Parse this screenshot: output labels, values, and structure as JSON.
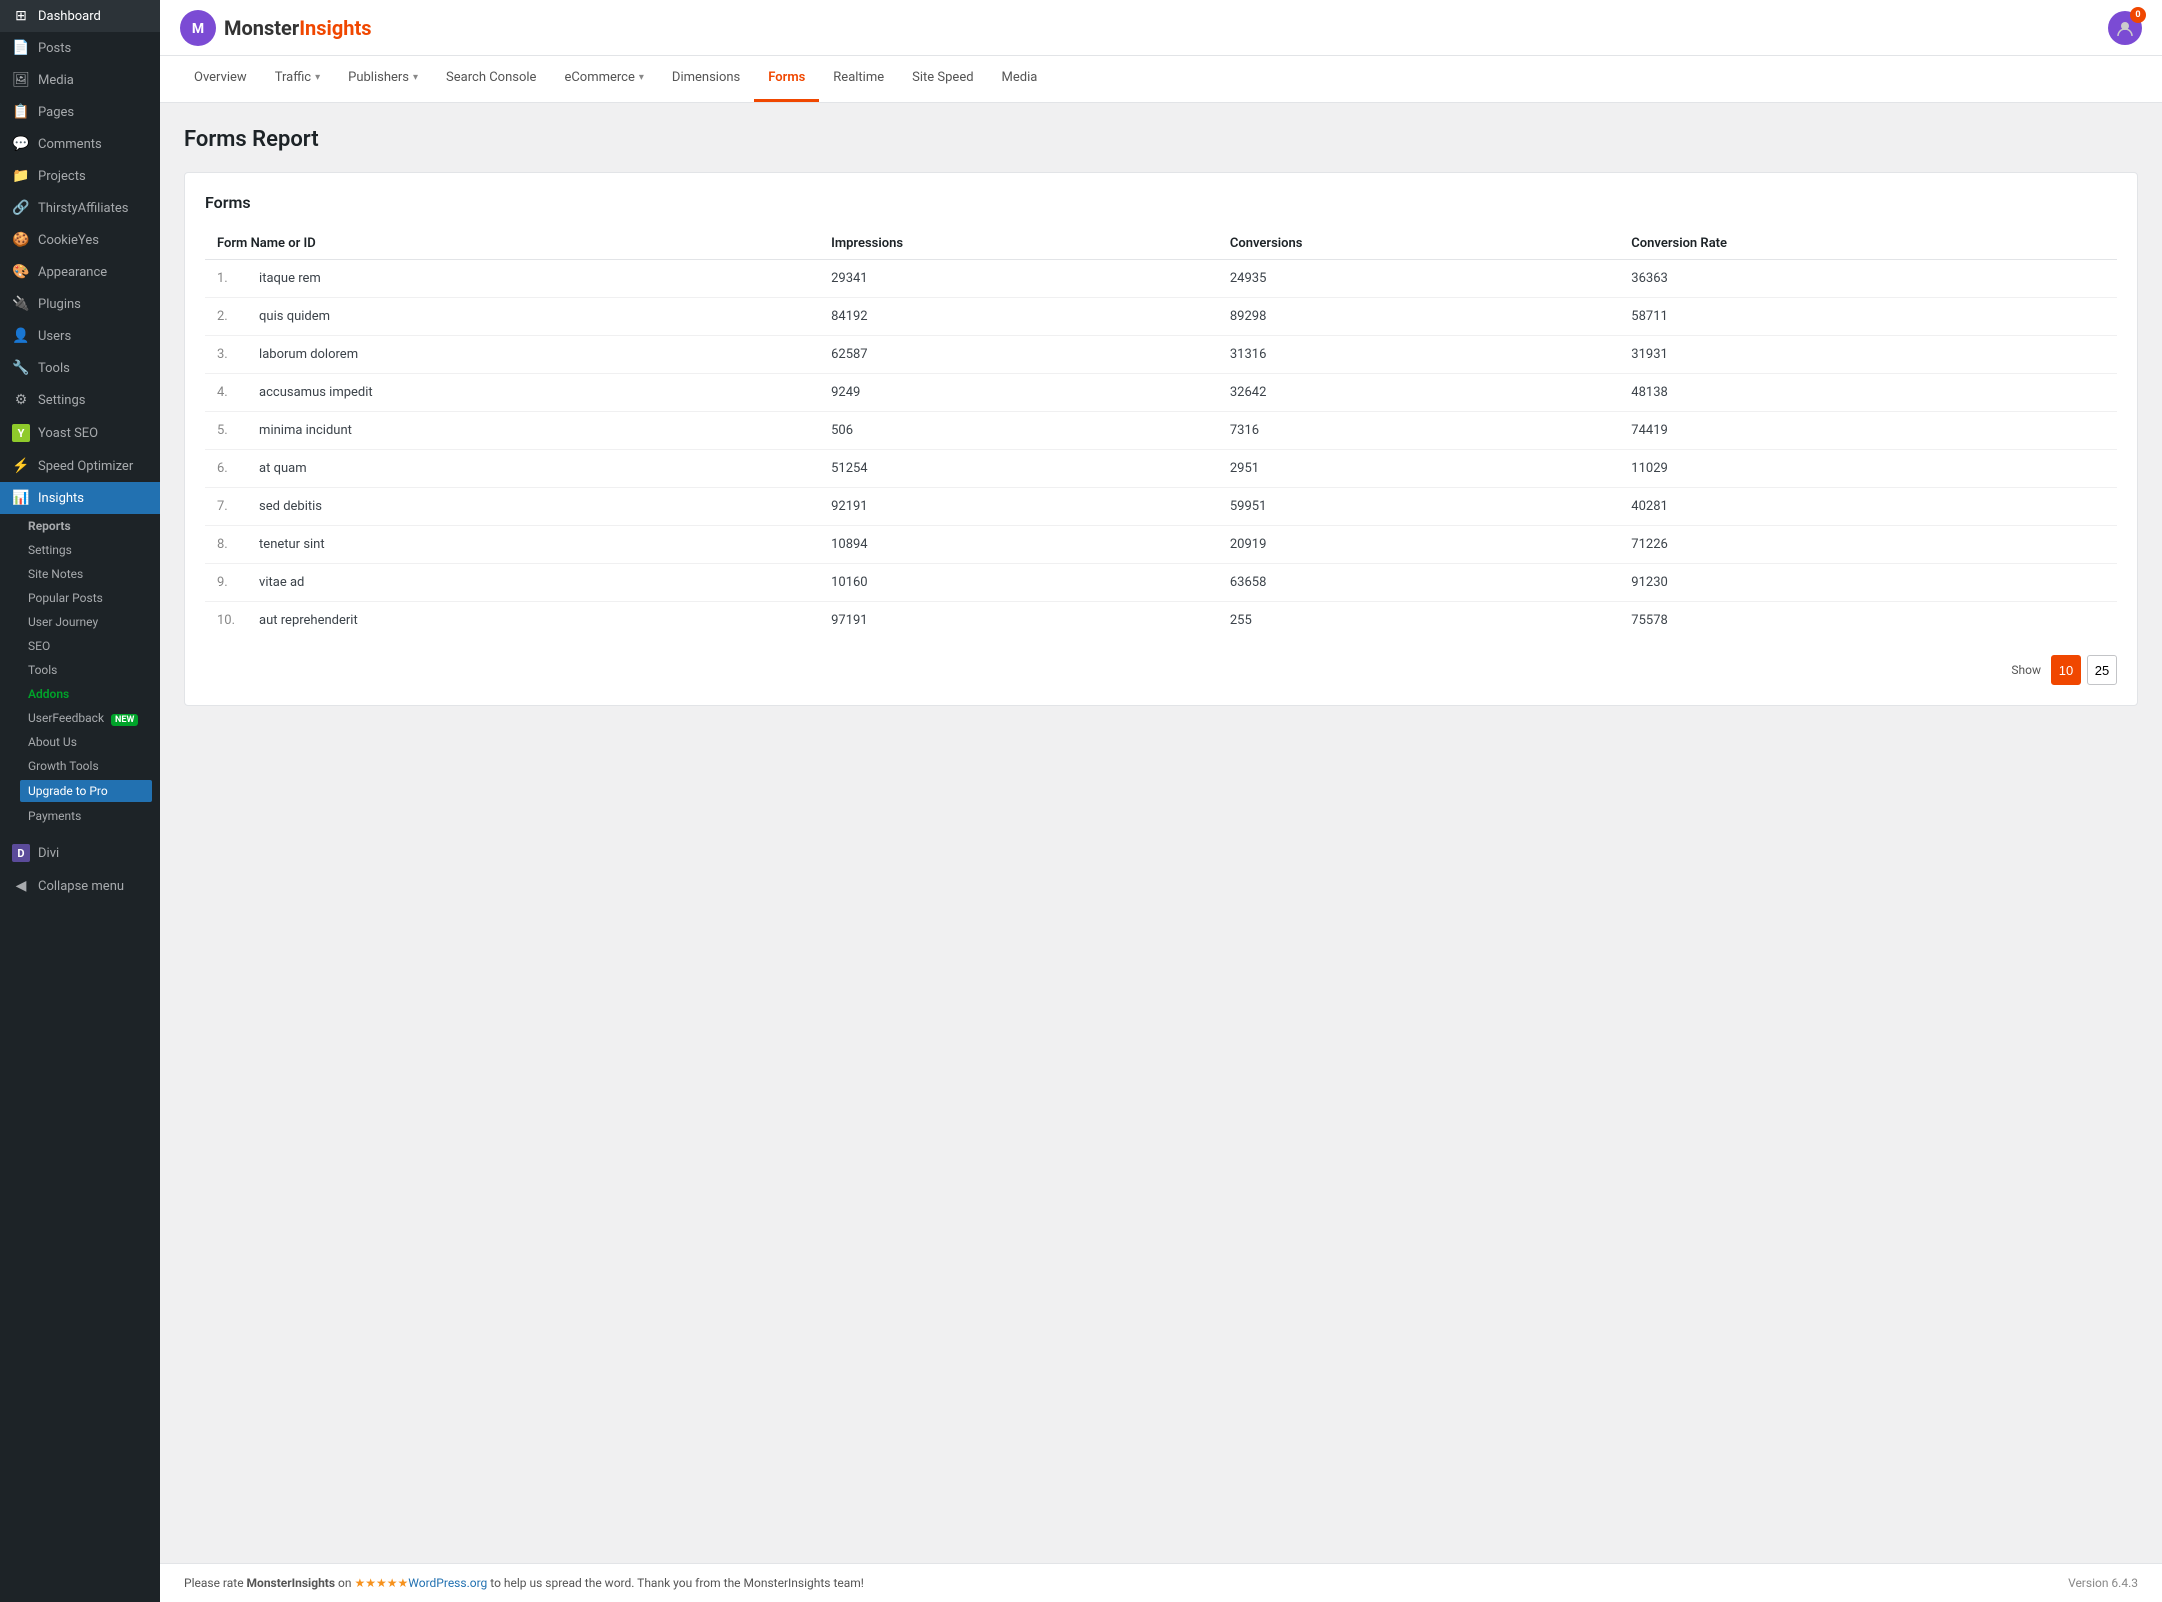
{
  "sidebar": {
    "items": [
      {
        "id": "dashboard",
        "label": "Dashboard",
        "icon": "⊞"
      },
      {
        "id": "posts",
        "label": "Posts",
        "icon": "📄"
      },
      {
        "id": "media",
        "label": "Media",
        "icon": "🖼"
      },
      {
        "id": "pages",
        "label": "Pages",
        "icon": "📋"
      },
      {
        "id": "comments",
        "label": "Comments",
        "icon": "💬"
      },
      {
        "id": "projects",
        "label": "Projects",
        "icon": "📁"
      },
      {
        "id": "thirstyaffiliates",
        "label": "ThirstyAffiliates",
        "icon": "🔗"
      },
      {
        "id": "cookieyes",
        "label": "CookieYes",
        "icon": "🍪"
      },
      {
        "id": "appearance",
        "label": "Appearance",
        "icon": "🎨"
      },
      {
        "id": "plugins",
        "label": "Plugins",
        "icon": "🔌"
      },
      {
        "id": "users",
        "label": "Users",
        "icon": "👤"
      },
      {
        "id": "tools",
        "label": "Tools",
        "icon": "🔧"
      },
      {
        "id": "settings",
        "label": "Settings",
        "icon": "⚙"
      },
      {
        "id": "yoast-seo",
        "label": "Yoast SEO",
        "icon": "Y"
      },
      {
        "id": "speed-optimizer",
        "label": "Speed Optimizer",
        "icon": "⚡"
      },
      {
        "id": "insights",
        "label": "Insights",
        "icon": "📊",
        "active": true
      }
    ],
    "sub_items": [
      {
        "id": "reports",
        "label": "Reports",
        "bold": true
      },
      {
        "id": "settings",
        "label": "Settings"
      },
      {
        "id": "site-notes",
        "label": "Site Notes"
      },
      {
        "id": "popular-posts",
        "label": "Popular Posts"
      },
      {
        "id": "user-journey",
        "label": "User Journey"
      },
      {
        "id": "seo",
        "label": "SEO"
      },
      {
        "id": "tools",
        "label": "Tools"
      },
      {
        "id": "addons",
        "label": "Addons",
        "green": true
      },
      {
        "id": "userfeedback",
        "label": "UserFeedback",
        "new": true
      },
      {
        "id": "about-us",
        "label": "About Us"
      },
      {
        "id": "growth-tools",
        "label": "Growth Tools"
      },
      {
        "id": "upgrade-to-pro",
        "label": "Upgrade to Pro",
        "highlight": true
      },
      {
        "id": "payments",
        "label": "Payments"
      }
    ],
    "divi": {
      "label": "Divi",
      "icon": "D"
    },
    "collapse": "Collapse menu"
  },
  "header": {
    "logo_monster": "Monster",
    "logo_insights": "Insights",
    "avatar_badge": "0"
  },
  "nav": {
    "tabs": [
      {
        "id": "overview",
        "label": "Overview",
        "active": false,
        "has_arrow": false
      },
      {
        "id": "traffic",
        "label": "Traffic",
        "active": false,
        "has_arrow": true
      },
      {
        "id": "publishers",
        "label": "Publishers",
        "active": false,
        "has_arrow": true
      },
      {
        "id": "search-console",
        "label": "Search Console",
        "active": false,
        "has_arrow": false
      },
      {
        "id": "ecommerce",
        "label": "eCommerce",
        "active": false,
        "has_arrow": true
      },
      {
        "id": "dimensions",
        "label": "Dimensions",
        "active": false,
        "has_arrow": false
      },
      {
        "id": "forms",
        "label": "Forms",
        "active": true,
        "has_arrow": false
      },
      {
        "id": "realtime",
        "label": "Realtime",
        "active": false,
        "has_arrow": false
      },
      {
        "id": "site-speed",
        "label": "Site Speed",
        "active": false,
        "has_arrow": false
      },
      {
        "id": "media",
        "label": "Media",
        "active": false,
        "has_arrow": false
      }
    ]
  },
  "page": {
    "title": "Forms Report",
    "table_title": "Forms",
    "columns": {
      "name": "Form Name or ID",
      "impressions": "Impressions",
      "conversions": "Conversions",
      "conversion_rate": "Conversion Rate"
    },
    "rows": [
      {
        "num": "1.",
        "name": "itaque rem",
        "impressions": "29341",
        "conversions": "24935",
        "conversion_rate": "36363"
      },
      {
        "num": "2.",
        "name": "quis quidem",
        "impressions": "84192",
        "conversions": "89298",
        "conversion_rate": "58711"
      },
      {
        "num": "3.",
        "name": "laborum dolorem",
        "impressions": "62587",
        "conversions": "31316",
        "conversion_rate": "31931"
      },
      {
        "num": "4.",
        "name": "accusamus impedit",
        "impressions": "9249",
        "conversions": "32642",
        "conversion_rate": "48138"
      },
      {
        "num": "5.",
        "name": "minima incidunt",
        "impressions": "506",
        "conversions": "7316",
        "conversion_rate": "74419"
      },
      {
        "num": "6.",
        "name": "at quam",
        "impressions": "51254",
        "conversions": "2951",
        "conversion_rate": "11029"
      },
      {
        "num": "7.",
        "name": "sed debitis",
        "impressions": "92191",
        "conversions": "59951",
        "conversion_rate": "40281"
      },
      {
        "num": "8.",
        "name": "tenetur sint",
        "impressions": "10894",
        "conversions": "20919",
        "conversion_rate": "71226"
      },
      {
        "num": "9.",
        "name": "vitae ad",
        "impressions": "10160",
        "conversions": "63658",
        "conversion_rate": "91230"
      },
      {
        "num": "10.",
        "name": "aut reprehenderit",
        "impressions": "97191",
        "conversions": "255",
        "conversion_rate": "75578"
      }
    ],
    "show_label": "Show",
    "pagination": [
      "10",
      "25"
    ]
  },
  "footer": {
    "text_before": "Please rate ",
    "brand": "MonsterInsights",
    "text_middle": " on ",
    "stars": "★★★★★",
    "link_text": "WordPress.org",
    "link_url": "#",
    "text_after": " to help us spread the word. Thank you from the MonsterInsights team!",
    "version": "Version 6.4.3"
  }
}
